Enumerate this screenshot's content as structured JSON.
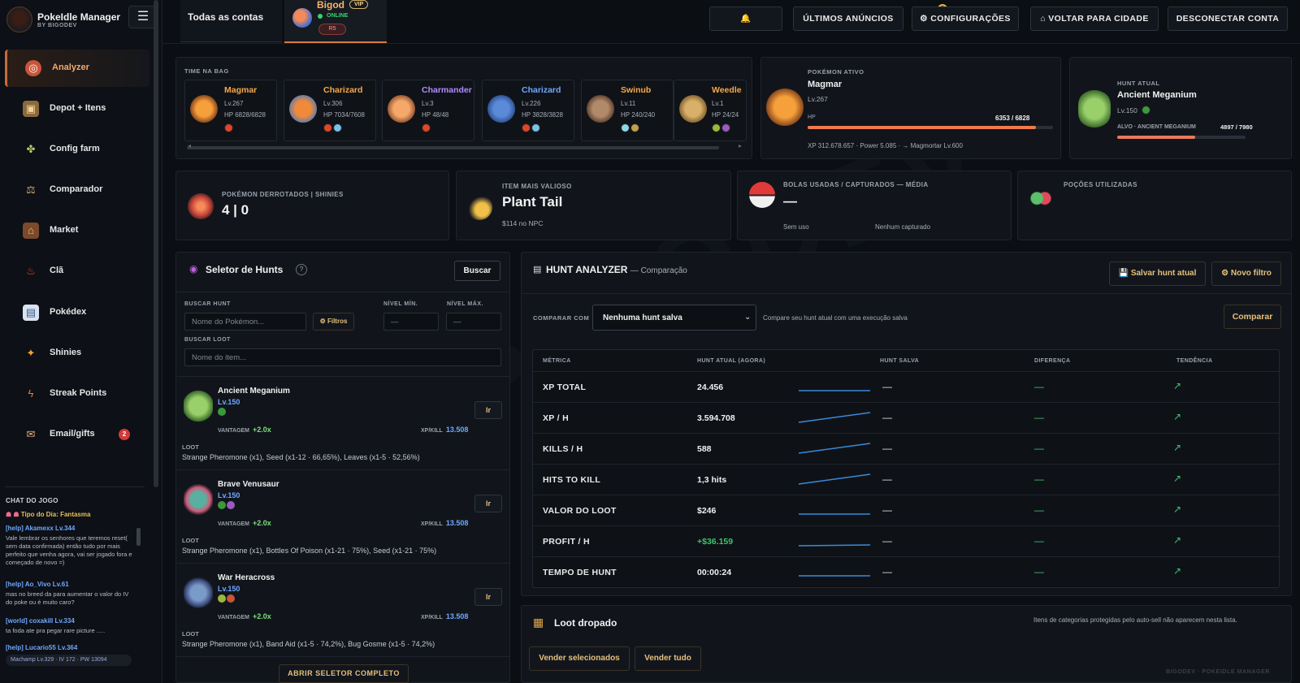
{
  "brand": {
    "title": "PokeIdle Manager",
    "subtitle": "BY BIGODEV"
  },
  "sidebar": {
    "items": [
      {
        "label": "Analyzer",
        "icon": "target-icon",
        "active": true
      },
      {
        "label": "Depot + Itens",
        "icon": "box-icon"
      },
      {
        "label": "Config farm",
        "icon": "farm-icon"
      },
      {
        "label": "Comparador",
        "icon": "compare-icon"
      },
      {
        "label": "Market",
        "icon": "market-icon"
      },
      {
        "label": "Clã",
        "icon": "clan-icon"
      },
      {
        "label": "Pokédex",
        "icon": "book-icon"
      },
      {
        "label": "Shinies",
        "icon": "sparkle-icon"
      },
      {
        "label": "Streak Points",
        "icon": "streak-icon"
      },
      {
        "label": "Email/gifts",
        "icon": "mail-icon",
        "badge": "2"
      }
    ]
  },
  "chat": {
    "title": "CHAT DO JOGO",
    "tip": "Tipo do Dia: Fantasma",
    "messages": [
      {
        "user": "[help] Akamexx Lv.344",
        "text": "Vale lembrar os senhores que teremos reset( sem data confirmada) então tudo por mais perfeito que venha agora, vai ser jogado fora e começado de novo =)"
      },
      {
        "user": "[help] Ao_Vivo Lv.61",
        "text": "mas no breed da para aumentar o valor do IV do poke ou é muito caro?"
      },
      {
        "user": "[world] coxakill Lv.334",
        "text": "ta foda ate pra pegar rare picture ....."
      },
      {
        "user": "[help] Lucario55 Lv.364",
        "text": ""
      }
    ],
    "bottom": "Machamp Lv.329 · IV 172 · PW 13094"
  },
  "topbar": {
    "all_accounts": "Todas as contas",
    "account": {
      "name": "Bigod",
      "vip": "VIP",
      "status": "ONLINE",
      "chip": "R5"
    },
    "bell_count": "6",
    "buttons": [
      "ÚLTIMOS ANÚNCIOS",
      "⚙ CONFIGURAÇÕES",
      "⌂ VOLTAR PARA CIDADE",
      "DESCONECTAR CONTA"
    ]
  },
  "team": {
    "title": "TIME NA BAG",
    "members": [
      {
        "name": "Magmar",
        "lv": "Lv.267",
        "hp": "HP 6828/6828",
        "color": "#f5a84a"
      },
      {
        "name": "Charizard",
        "lv": "Lv.306",
        "hp": "HP 7034/7608",
        "color": "#f5a84a"
      },
      {
        "name": "Charmander",
        "lv": "Lv.3",
        "hp": "HP 48/48",
        "color": "#b18cff"
      },
      {
        "name": "Charizard",
        "lv": "Lv.226",
        "hp": "HP 3828/3828",
        "color": "#6fa8ff"
      },
      {
        "name": "Swinub",
        "lv": "Lv.11",
        "hp": "HP 240/240",
        "color": "#f5a84a"
      },
      {
        "name": "Weedle",
        "lv": "Lv.1",
        "hp": "HP 24/24",
        "color": "#f5a84a"
      }
    ]
  },
  "active_pokemon": {
    "title": "POKÉMON ATIVO",
    "name": "Magmar",
    "lv": "Lv.267",
    "hp_label": "HP",
    "hp_text": "6353 / 6828",
    "hp_fraction": 0.93,
    "footer": "XP 312.678.657 · Power 5.085 · → Magmortar Lv.600"
  },
  "current_hunt": {
    "title": "HUNT ATUAL",
    "name": "Ancient Meganium",
    "lv": "Lv.150",
    "target_label": "ALVO · ANCIENT MEGANIUM",
    "progress_text": "4897 / 7980",
    "progress_fraction": 0.61
  },
  "stats": {
    "defeated": {
      "title": "POKÉMON DERROTADOS | SHINIES",
      "value": "4 | 0"
    },
    "valuable": {
      "title": "ITEM MAIS VALIOSO",
      "value": "Plant Tail",
      "sub": "$114 no NPC"
    },
    "balls": {
      "title": "BOLAS USADAS / CAPTURADOS — MÉDIA",
      "value": "—",
      "sub1": "Sem uso",
      "sub2": "Nenhum capturado"
    },
    "potions": {
      "title": "POÇÕES UTILIZADAS"
    }
  },
  "hunt_selector": {
    "title": "Seletor de Hunts",
    "help": "?",
    "search_btn": "Buscar",
    "hunt_label": "BUSCAR HUNT",
    "hunt_placeholder": "Nome do Pokémon...",
    "filters": "⚙ Filtros",
    "min_label": "NÍVEL MÍN.",
    "max_label": "NÍVEL MÁX.",
    "min_placeholder": "—",
    "max_placeholder": "—",
    "loot_label": "BUSCAR LOOT",
    "loot_placeholder": "Nome do item...",
    "vantage_label": "VANTAGEM",
    "xpkill_label": "XP/KILL",
    "go_label": "Ir",
    "loot_title": "LOOT",
    "hunts": [
      {
        "name": "Ancient Meganium",
        "lv": "Lv.150",
        "vantage": "+2.0x",
        "xpkill": "13.508",
        "loot": "Strange Pheromone (x1), Seed (x1-12 · 66,65%), Leaves (x1-5 · 52,56%)"
      },
      {
        "name": "Brave Venusaur",
        "lv": "Lv.150",
        "vantage": "+2.0x",
        "xpkill": "13.508",
        "loot": "Strange Pheromone (x1), Bottles Of Poison (x1-21 · 75%), Seed (x1-21 · 75%)"
      },
      {
        "name": "War Heracross",
        "lv": "Lv.150",
        "vantage": "+2.0x",
        "xpkill": "13.508",
        "loot": "Strange Pheromone (x1), Band Aid (x1-5 · 74,2%), Bug Gosme (x1-5 · 74,2%)"
      }
    ],
    "open_full": "ABRIR SELETOR COMPLETO"
  },
  "analyzer": {
    "title": "HUNT ANALYZER",
    "subtitle": "— Comparação",
    "save_btn": "💾 Salvar hunt atual",
    "filter_btn": "⚙ Novo filtro",
    "compare_label": "COMPARAR COM",
    "compare_value": "Nenhuma hunt salva",
    "compare_hint": "Compare seu hunt atual com uma execução salva",
    "compare_btn": "Comparar",
    "headers": [
      "MÉTRICA",
      "HUNT ATUAL (AGORA)",
      "HUNT SALVA",
      "DIFERENÇA",
      "TENDÊNCIA"
    ],
    "rows": [
      {
        "metric": "XP TOTAL",
        "value": "24.456",
        "saved": "—",
        "diff": "—",
        "trend": "↗"
      },
      {
        "metric": "XP / H",
        "value": "3.594.708",
        "saved": "—",
        "diff": "—",
        "trend": "↗"
      },
      {
        "metric": "KILLS / H",
        "value": "588",
        "saved": "—",
        "diff": "—",
        "trend": "↗"
      },
      {
        "metric": "HITS TO KILL",
        "value": "1,3 hits",
        "saved": "—",
        "diff": "—",
        "trend": "↗"
      },
      {
        "metric": "VALOR DO LOOT",
        "value": "$246",
        "saved": "—",
        "diff": "—",
        "trend": "↗"
      },
      {
        "metric": "PROFIT / H",
        "value": "+$36.159",
        "saved": "—",
        "diff": "—",
        "trend": "↗"
      },
      {
        "metric": "TEMPO DE HUNT",
        "value": "00:00:24",
        "saved": "—",
        "diff": "—",
        "trend": "↗"
      }
    ]
  },
  "loot": {
    "title": "Loot dropado",
    "hint": "Itens de categorias protegidas pelo auto-sell não aparecem nesta lista.",
    "sell_selected": "Vender selecionados",
    "sell_all": "Vender tudo",
    "footer": "BIGODEV · POKEIDLE MANAGER"
  },
  "colors": {
    "accent": "#d47a3a",
    "green": "#3ec46b",
    "blue": "#6fa8ff",
    "bg": "#0b0e13"
  }
}
